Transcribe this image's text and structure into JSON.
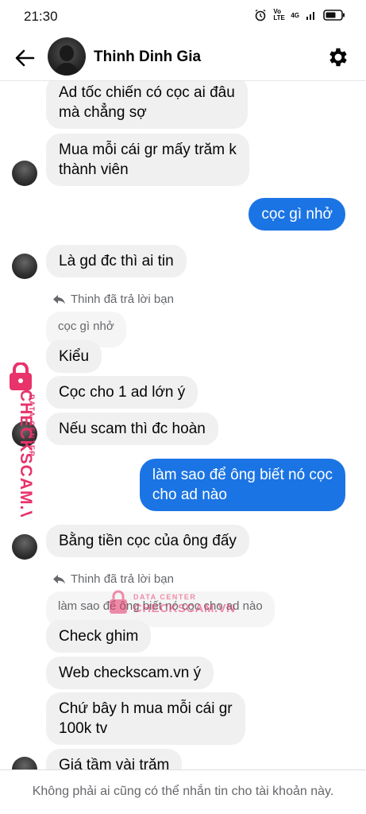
{
  "status_bar": {
    "time": "21:30",
    "network_label": "Vo LTE",
    "signal_label": "4G"
  },
  "header": {
    "contact_name": "Thinh Dinh Gia"
  },
  "messages": [
    {
      "text": "Ad tốc chiến có cọc ai đâu\nmà chẳng sợ"
    },
    {
      "text": "Mua mỗi cái gr mấy trăm k\nthành viên"
    },
    {
      "text": "cọc gì nhở"
    },
    {
      "text": "Là gd đc thì ai tin"
    },
    {
      "text": "Kiểu"
    },
    {
      "text": "Cọc cho 1 ad lớn ý"
    },
    {
      "text": "Nếu scam thì đc hoàn"
    },
    {
      "text": "làm sao để ông biết nó cọc\ncho ad nào"
    },
    {
      "text": "Bằng tiền cọc của ông đấy"
    },
    {
      "text": "Check ghim"
    },
    {
      "text": "Web checkscam.vn ý"
    },
    {
      "text": "Chứ bây h mua mỗi cái gr\n100k tv"
    },
    {
      "text": "Giá tầm vài trăm"
    }
  ],
  "replies": [
    {
      "label": "Thinh đã trả lời bạn",
      "quoted": "cọc gì nhở"
    },
    {
      "label": "Thinh đã trả lời bạn",
      "quoted": "làm sao để ông biết nó cọc cho ad nào"
    }
  ],
  "watermark": {
    "line1": "DATA CENTER",
    "line2": "CHECKSCAM.VN"
  },
  "footer": {
    "text": "Không phải ai cũng có thể nhắn tin cho tài khoản này."
  },
  "colors": {
    "outgoing": "#1b74e4",
    "incoming": "#f0f0f0",
    "watermark": "#e8336b"
  }
}
